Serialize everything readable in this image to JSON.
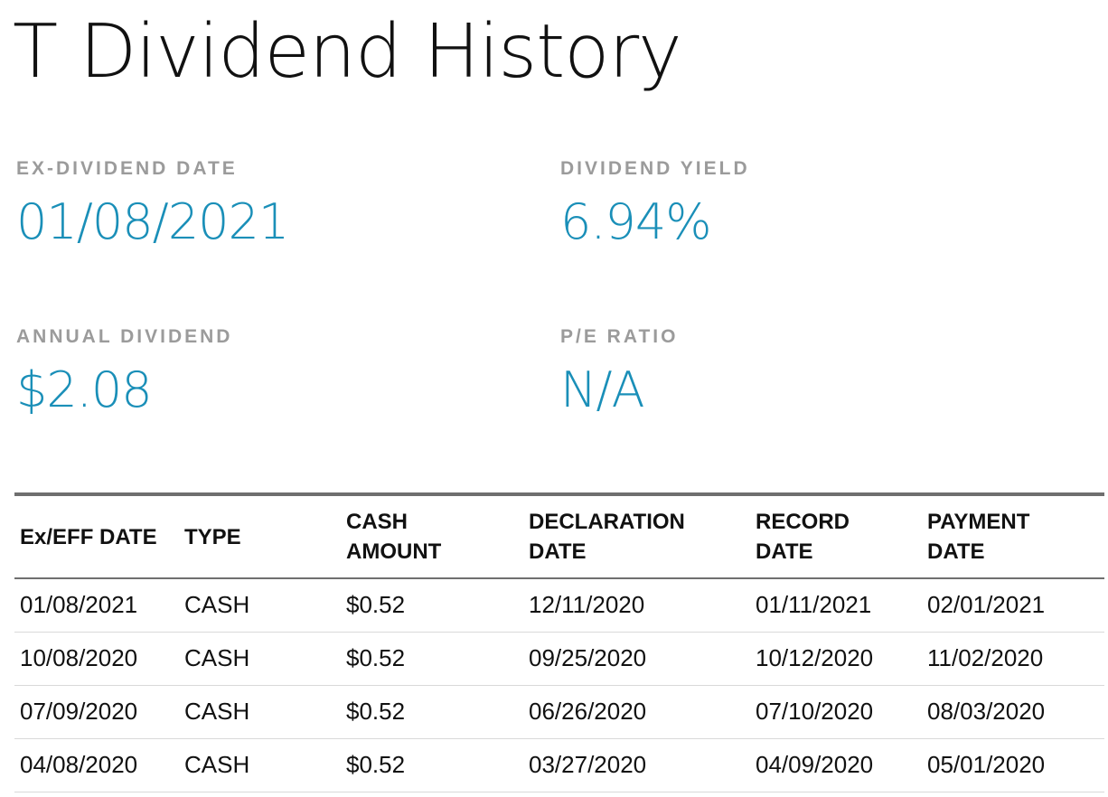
{
  "page": {
    "title": "T Dividend History"
  },
  "colors": {
    "accent": "#1a8fb8",
    "label": "#9b9b9b",
    "text": "#111111",
    "rule": "#6f6f6f"
  },
  "stats": {
    "ex_dividend_date": {
      "label": "EX-DIVIDEND DATE",
      "value": "01/08/2021"
    },
    "dividend_yield": {
      "label": "DIVIDEND YIELD",
      "value": "6.94%"
    },
    "annual_dividend": {
      "label": "ANNUAL DIVIDEND",
      "value": "$2.08"
    },
    "pe_ratio": {
      "label": "P/E RATIO",
      "value": "N/A"
    }
  },
  "table": {
    "headers": [
      {
        "line1": "Ex/EFF DATE",
        "line2": ""
      },
      {
        "line1": "TYPE",
        "line2": ""
      },
      {
        "line1": "CASH",
        "line2": "AMOUNT"
      },
      {
        "line1": "DECLARATION",
        "line2": "DATE"
      },
      {
        "line1": "RECORD",
        "line2": "DATE"
      },
      {
        "line1": "PAYMENT",
        "line2": "DATE"
      }
    ],
    "rows": [
      [
        "01/08/2021",
        "CASH",
        "$0.52",
        "12/11/2020",
        "01/11/2021",
        "02/01/2021"
      ],
      [
        "10/08/2020",
        "CASH",
        "$0.52",
        "09/25/2020",
        "10/12/2020",
        "11/02/2020"
      ],
      [
        "07/09/2020",
        "CASH",
        "$0.52",
        "06/26/2020",
        "07/10/2020",
        "08/03/2020"
      ],
      [
        "04/08/2020",
        "CASH",
        "$0.52",
        "03/27/2020",
        "04/09/2020",
        "05/01/2020"
      ]
    ]
  }
}
